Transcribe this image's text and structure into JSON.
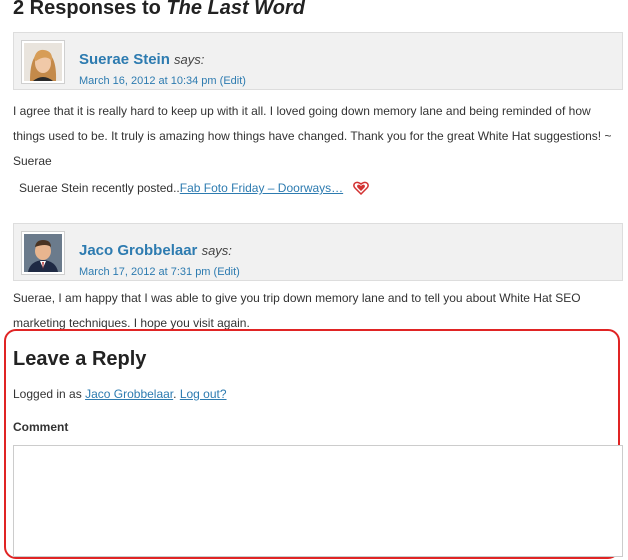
{
  "responses": {
    "heading_prefix": "2 Responses to",
    "heading_post": "The Last Word"
  },
  "comments": [
    {
      "author": "Suerae Stein",
      "says": "says:",
      "date": "March 16, 2012 at 10:34 pm",
      "edit": "(Edit)",
      "body": "I agree that it is really hard to keep up with it all. I loved going down memory lane and being reminded of how things used to be. It truly is amazing how things have changed. Thank you for the great White Hat suggestions! ~ Suerae",
      "recent_prefix": "Suerae Stein recently posted..",
      "recent_link": "Fab Foto Friday – Doorways…"
    },
    {
      "author": "Jaco Grobbelaar",
      "says": "says:",
      "date": "March 17, 2012 at 7:31 pm",
      "edit": "(Edit)",
      "body": "Suerae, I am happy that I was able to give you trip down memory lane and to tell you about White Hat SEO marketing techniques. I hope you visit again."
    }
  ],
  "reply": {
    "title": "Leave a Reply",
    "logged_in_prefix": "Logged in as",
    "user": "Jaco Grobbelaar",
    "sep": ". ",
    "logout": "Log out?",
    "comment_label": "Comment",
    "comment_value": ""
  },
  "colors": {
    "link": "#2d7bb0",
    "highlight_border": "#e02424",
    "header_bg": "#f1f1f1"
  },
  "icons": [
    "heart-icon"
  ]
}
